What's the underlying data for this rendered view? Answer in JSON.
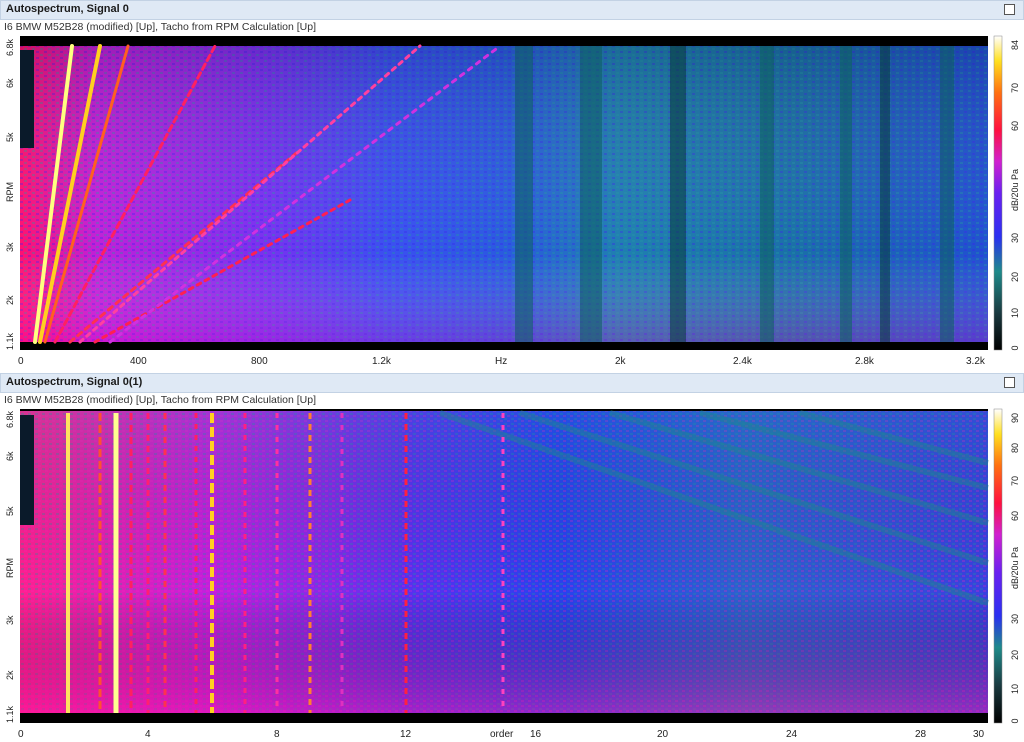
{
  "panels": [
    {
      "title": "Autospectrum, Signal 0",
      "subtitle": "I6 BMW M52B28 (modified) [Up], Tacho from RPM Calculation [Up]",
      "window_button_icon": "maximize-icon",
      "chart_data": {
        "type": "heatmap",
        "xlabel": "Hz",
        "ylabel": "RPM",
        "colorbar_label": "dB/20u Pa",
        "xlim": [
          0,
          3200
        ],
        "ylim": [
          1100,
          6800
        ],
        "x_ticks": [
          "0",
          "400",
          "800",
          "1.2k",
          "Hz",
          "2k",
          "2.4k",
          "2.8k",
          "3.2k"
        ],
        "y_ticks": [
          "1.1k",
          "2k",
          "3k",
          "RPM",
          "5k",
          "6k",
          "6.8k"
        ],
        "colorbar_range": [
          0,
          84
        ],
        "colorbar_ticks": [
          "84",
          "70",
          "60",
          "dB/20u Pa",
          "30",
          "20",
          "10",
          "0"
        ]
      }
    },
    {
      "title": "Autospectrum, Signal 0(1)",
      "subtitle": "I6 BMW M52B28 (modified) [Up], Tacho from RPM Calculation [Up]",
      "window_button_icon": "maximize-icon",
      "chart_data": {
        "type": "heatmap",
        "xlabel": "order",
        "ylabel": "RPM",
        "colorbar_label": "dB/20u Pa",
        "xlim": [
          0,
          30
        ],
        "ylim": [
          1100,
          6800
        ],
        "x_ticks": [
          "0",
          "4",
          "8",
          "12",
          "order",
          "16",
          "20",
          "24",
          "28",
          "30"
        ],
        "y_ticks": [
          "1.1k",
          "2k",
          "3k",
          "RPM",
          "5k",
          "6k",
          "6.8k"
        ],
        "colorbar_range": [
          0,
          90
        ],
        "colorbar_ticks": [
          "90",
          "80",
          "70",
          "60",
          "dB/20u Pa",
          "30",
          "20",
          "10",
          "0"
        ]
      }
    }
  ]
}
